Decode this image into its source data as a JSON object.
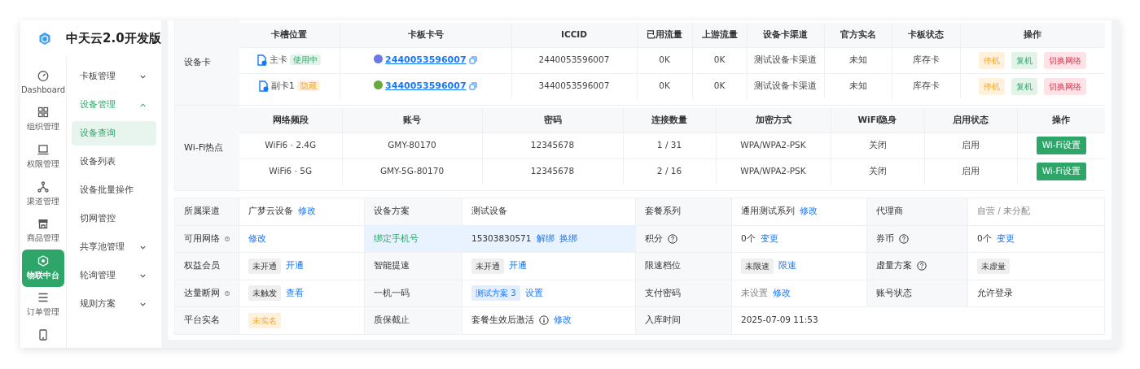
{
  "app": {
    "title": "中天云2.0开发版"
  },
  "rail": [
    {
      "label": "Dashboard",
      "selected": false
    },
    {
      "label": "组织管理",
      "selected": false
    },
    {
      "label": "权限管理",
      "selected": false
    },
    {
      "label": "渠道管理",
      "selected": false
    },
    {
      "label": "商品管理",
      "selected": false
    },
    {
      "label": "物联中台",
      "selected": true
    },
    {
      "label": "订单管理",
      "selected": false
    }
  ],
  "menu": [
    {
      "label": "卡板管理",
      "expanded": false
    },
    {
      "label": "设备管理",
      "expanded": true,
      "children": [
        {
          "label": "设备查询",
          "selected": true
        },
        {
          "label": "设备列表",
          "selected": false
        },
        {
          "label": "设备批量操作",
          "selected": false
        },
        {
          "label": "切网管控",
          "selected": false
        }
      ]
    },
    {
      "label": "共享池管理",
      "expanded": false
    },
    {
      "label": "轮询管理",
      "expanded": false
    },
    {
      "label": "规则方案",
      "expanded": false
    }
  ],
  "device_cards": {
    "label": "设备卡",
    "columns": [
      "卡槽位置",
      "卡板卡号",
      "ICCID",
      "已用流量",
      "上游流量",
      "设备卡渠道",
      "官方实名",
      "卡板状态",
      "操作"
    ],
    "rows": [
      {
        "slot": "主卡",
        "tag": {
          "text": "使用中",
          "kind": "success"
        },
        "card_no": "2440053596007",
        "color": "#6b78e5",
        "iccid": "2440053596007",
        "used": "0K",
        "upstream": "0K",
        "channel": "测试设备卡渠道",
        "real_name": "未知",
        "status": "库存卡",
        "actions": [
          {
            "text": "停机",
            "kind": "warning"
          },
          {
            "text": "复机",
            "kind": "success"
          },
          {
            "text": "切换网络",
            "kind": "danger"
          }
        ]
      },
      {
        "slot": "副卡1",
        "tag": {
          "text": "隐藏",
          "kind": "warning"
        },
        "card_no": "3440053596007",
        "color": "#6aaa3a",
        "iccid": "3440053596007",
        "used": "0K",
        "upstream": "0K",
        "channel": "测试设备卡渠道",
        "real_name": "未知",
        "status": "库存卡",
        "actions": [
          {
            "text": "停机",
            "kind": "warning"
          },
          {
            "text": "复机",
            "kind": "success"
          },
          {
            "text": "切换网络",
            "kind": "danger"
          }
        ]
      }
    ]
  },
  "wifi": {
    "label": "Wi-Fi热点",
    "columns": [
      "网络频段",
      "账号",
      "密码",
      "连接数量",
      "加密方式",
      "WiFi隐身",
      "启用状态",
      "操作"
    ],
    "rows": [
      {
        "cells": [
          "WiFi6 · 2.4G",
          "GMY-80170",
          "12345678",
          "1 / 31",
          "WPA/WPA2-PSK",
          "关闭",
          "启用"
        ],
        "button": "Wi-Fi设置"
      },
      {
        "cells": [
          "WiFi6 · 5G",
          "GMY-5G-80170",
          "12345678",
          "2 / 16",
          "WPA/WPA2-PSK",
          "关闭",
          "启用"
        ],
        "button": "Wi-Fi设置"
      }
    ]
  },
  "info": [
    [
      {
        "kind": "label",
        "highlighted": false,
        "parts": [
          {
            "kind": "text",
            "text": "所属渠道"
          }
        ]
      },
      {
        "kind": "value",
        "highlighted": false,
        "parts": [
          {
            "kind": "text",
            "text": "广梦云设备"
          },
          {
            "kind": "link",
            "text": "修改"
          }
        ]
      },
      {
        "kind": "label",
        "highlighted": false,
        "parts": [
          {
            "kind": "text",
            "text": "设备方案"
          }
        ]
      },
      {
        "kind": "value",
        "highlighted": false,
        "parts": [
          {
            "kind": "text",
            "text": "测试设备"
          }
        ]
      },
      {
        "kind": "label",
        "highlighted": false,
        "parts": [
          {
            "kind": "text",
            "text": "套餐系列"
          }
        ]
      },
      {
        "kind": "value",
        "highlighted": false,
        "parts": [
          {
            "kind": "text",
            "text": "通用测试系列"
          },
          {
            "kind": "link",
            "text": "修改"
          }
        ]
      },
      {
        "kind": "label",
        "highlighted": false,
        "parts": [
          {
            "kind": "text",
            "text": "代理商"
          }
        ]
      },
      {
        "kind": "value",
        "highlighted": false,
        "parts": [
          {
            "kind": "muted",
            "text": "自营 / 未分配"
          }
        ]
      }
    ],
    [
      {
        "kind": "label",
        "highlighted": false,
        "parts": [
          {
            "kind": "text",
            "text": "可用网络"
          },
          {
            "kind": "help"
          }
        ]
      },
      {
        "kind": "value",
        "highlighted": false,
        "parts": [
          {
            "kind": "link",
            "text": "修改"
          }
        ]
      },
      {
        "kind": "label",
        "highlighted": true,
        "parts": [
          {
            "kind": "green",
            "text": "绑定手机号"
          }
        ]
      },
      {
        "kind": "value",
        "highlighted": true,
        "parts": [
          {
            "kind": "text",
            "text": "15303830571"
          },
          {
            "kind": "link",
            "text": "解绑"
          },
          {
            "kind": "link",
            "text": "换绑"
          }
        ]
      },
      {
        "kind": "label",
        "highlighted": false,
        "parts": [
          {
            "kind": "text",
            "text": "积分"
          },
          {
            "kind": "help"
          }
        ]
      },
      {
        "kind": "value",
        "highlighted": false,
        "parts": [
          {
            "kind": "text",
            "text": "0个"
          },
          {
            "kind": "link",
            "text": "变更"
          }
        ]
      },
      {
        "kind": "label",
        "highlighted": false,
        "parts": [
          {
            "kind": "text",
            "text": "券币"
          },
          {
            "kind": "help"
          }
        ]
      },
      {
        "kind": "value",
        "highlighted": false,
        "parts": [
          {
            "kind": "text",
            "text": "0个"
          },
          {
            "kind": "link",
            "text": "变更"
          }
        ]
      }
    ],
    [
      {
        "kind": "label",
        "highlighted": false,
        "parts": [
          {
            "kind": "text",
            "text": "权益会员"
          }
        ]
      },
      {
        "kind": "value",
        "highlighted": false,
        "parts": [
          {
            "kind": "tag-gray",
            "text": "未开通"
          },
          {
            "kind": "link",
            "text": "开通"
          }
        ]
      },
      {
        "kind": "label",
        "highlighted": false,
        "parts": [
          {
            "kind": "text",
            "text": "智能提速"
          }
        ]
      },
      {
        "kind": "value",
        "highlighted": false,
        "parts": [
          {
            "kind": "tag-gray",
            "text": "未开通"
          },
          {
            "kind": "link",
            "text": "开通"
          }
        ]
      },
      {
        "kind": "label",
        "highlighted": false,
        "parts": [
          {
            "kind": "text",
            "text": "限速档位"
          }
        ]
      },
      {
        "kind": "value",
        "highlighted": false,
        "parts": [
          {
            "kind": "tag-gray",
            "text": "未限速"
          },
          {
            "kind": "link",
            "text": "限速"
          }
        ]
      },
      {
        "kind": "label",
        "highlighted": false,
        "parts": [
          {
            "kind": "text",
            "text": "虚量方案"
          },
          {
            "kind": "help"
          }
        ]
      },
      {
        "kind": "value",
        "highlighted": false,
        "parts": [
          {
            "kind": "tag-gray",
            "text": "未虚量"
          }
        ]
      }
    ],
    [
      {
        "kind": "label",
        "highlighted": false,
        "parts": [
          {
            "kind": "text",
            "text": "达量断网"
          },
          {
            "kind": "help"
          }
        ]
      },
      {
        "kind": "value",
        "highlighted": false,
        "parts": [
          {
            "kind": "tag-gray",
            "text": "未触发"
          },
          {
            "kind": "link",
            "text": "查看"
          }
        ]
      },
      {
        "kind": "label",
        "highlighted": false,
        "parts": [
          {
            "kind": "text",
            "text": "一机一码"
          }
        ]
      },
      {
        "kind": "value",
        "highlighted": false,
        "parts": [
          {
            "kind": "tag-blue",
            "text": "测试方案 3"
          },
          {
            "kind": "link",
            "text": "设置"
          }
        ]
      },
      {
        "kind": "label",
        "highlighted": false,
        "parts": [
          {
            "kind": "text",
            "text": "支付密码"
          }
        ]
      },
      {
        "kind": "value",
        "highlighted": false,
        "parts": [
          {
            "kind": "muted",
            "text": "未设置"
          },
          {
            "kind": "link",
            "text": "修改"
          }
        ]
      },
      {
        "kind": "label",
        "highlighted": false,
        "parts": [
          {
            "kind": "text",
            "text": "账号状态"
          }
        ]
      },
      {
        "kind": "value",
        "highlighted": false,
        "parts": [
          {
            "kind": "text",
            "text": "允许登录"
          }
        ]
      }
    ],
    [
      {
        "kind": "label",
        "highlighted": false,
        "parts": [
          {
            "kind": "text",
            "text": "平台实名"
          }
        ]
      },
      {
        "kind": "value",
        "highlighted": false,
        "parts": [
          {
            "kind": "tag-warning",
            "text": "未实名"
          }
        ]
      },
      {
        "kind": "label",
        "highlighted": false,
        "parts": [
          {
            "kind": "text",
            "text": "质保截止"
          }
        ]
      },
      {
        "kind": "value",
        "highlighted": false,
        "parts": [
          {
            "kind": "text",
            "text": "套餐生效后激活"
          },
          {
            "kind": "info"
          },
          {
            "kind": "link",
            "text": "修改"
          }
        ]
      },
      {
        "kind": "label",
        "highlighted": false,
        "parts": [
          {
            "kind": "text",
            "text": "入库时间"
          }
        ]
      },
      {
        "kind": "value",
        "highlighted": false,
        "parts": [
          {
            "kind": "text",
            "text": "2025-07-09 11:53"
          }
        ]
      }
    ]
  ]
}
